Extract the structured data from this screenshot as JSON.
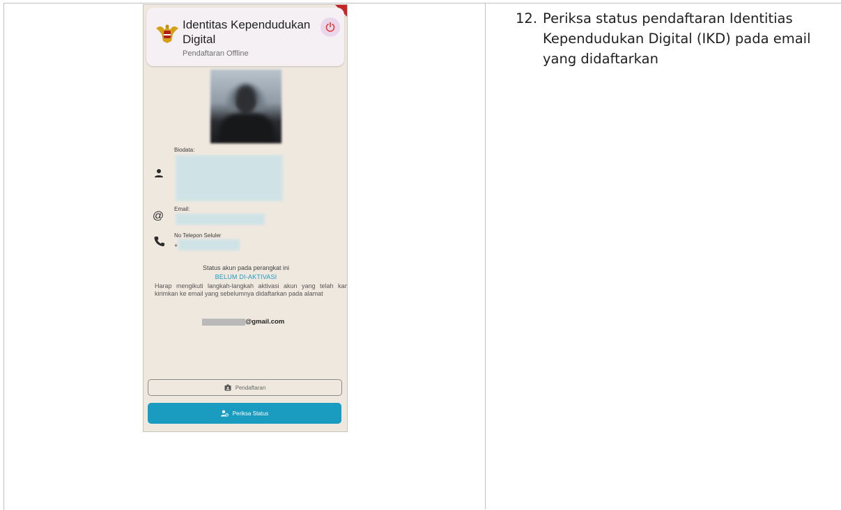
{
  "app": {
    "title": "Identitas Kependudukan Digital",
    "subtitle": "Pendaftaran Offline"
  },
  "profile": {
    "biodata_label": "Biodata:",
    "email_label": "Email:",
    "phone_label": "No Telepon Seluler",
    "phone_prefix": "+"
  },
  "status": {
    "line1": "Status akun pada perangkat ini",
    "value": "BELUM DI-AKTIVASI",
    "message": "Harap mengikuti langkah-langkah aktivasi akun yang telah kami kirimkan ke email yang sebelumnya didaftarkan pada alamat",
    "email_suffix": "@gmail.com",
    "accent_color": "#1a9bc0"
  },
  "buttons": {
    "register": "Pendaftaran",
    "check_status": "Periksa Status"
  },
  "instruction": {
    "number": "12.",
    "text": "Periksa status pendaftaran Identitias Kependudukan Digital (IKD) pada email yang didaftarkan"
  },
  "icons": [
    "garuda-emblem-icon",
    "power-icon",
    "person-icon",
    "at-sign-icon",
    "phone-icon",
    "id-card-icon",
    "user-gear-icon"
  ]
}
